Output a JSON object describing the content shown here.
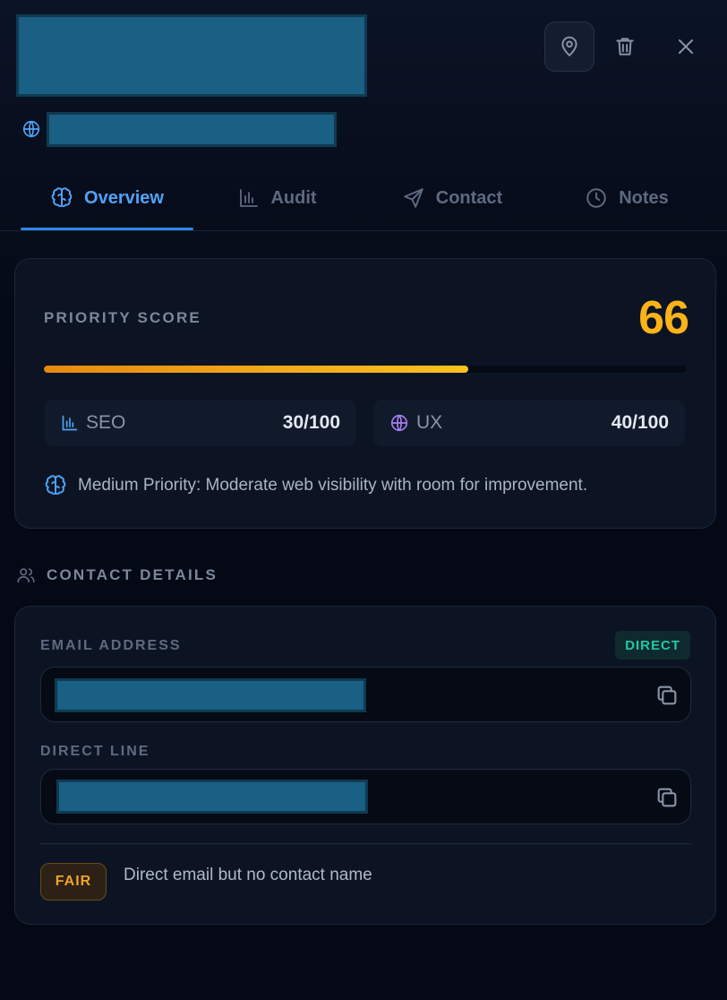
{
  "header": {
    "colors": {
      "accent": "#4fa3f7",
      "score": "#fbb318"
    }
  },
  "tabs": [
    {
      "label": "Overview",
      "icon": "brain-icon",
      "active": true
    },
    {
      "label": "Audit",
      "icon": "bar-chart-icon",
      "active": false
    },
    {
      "label": "Contact",
      "icon": "send-icon",
      "active": false
    },
    {
      "label": "Notes",
      "icon": "clock-icon",
      "active": false
    }
  ],
  "score": {
    "label": "PRIORITY SCORE",
    "value": "66",
    "progress_percent": 66,
    "seo": {
      "label": "SEO",
      "value": "30/100"
    },
    "ux": {
      "label": "UX",
      "value": "40/100"
    },
    "summary": "Medium Priority: Moderate web visibility with room for improvement."
  },
  "contact": {
    "heading": "CONTACT DETAILS",
    "email_label": "EMAIL ADDRESS",
    "email_badge": "DIRECT",
    "direct_label": "DIRECT LINE",
    "quality_badge": "FAIR",
    "quality_text": "Direct email but no contact name"
  }
}
